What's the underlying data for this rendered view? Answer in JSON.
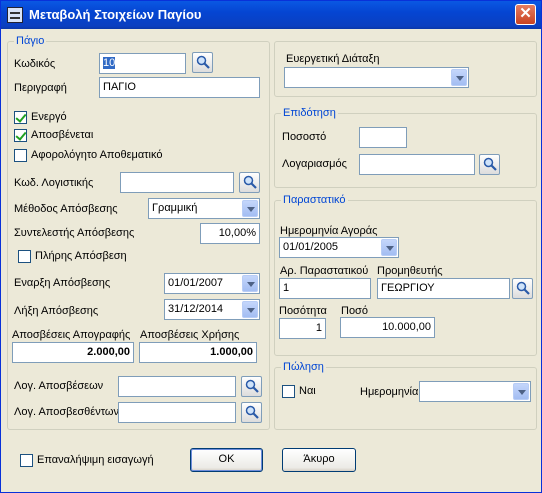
{
  "window": {
    "title": "Μεταβολή Στοιχείων Παγίου",
    "close": "✕"
  },
  "asset": {
    "legend": "Πάγιο",
    "code_label": "Κωδικός",
    "code_value": "10",
    "description_label": "Περιγραφή",
    "description_value": "ΠΑΓΙΟ",
    "active_label": "Ενεργό",
    "depreciated_label": "Αποσβένεται",
    "taxfree_label": "Αφορολόγητο Αποθεματικό",
    "account_code_label": "Κωδ. Λογιστικής",
    "account_code_value": "",
    "method_label": "Μέθοδος Απόσβεσης",
    "method_value": "Γραμμική",
    "rate_label": "Συντελεστής Απόσβεσης",
    "rate_value": "10,00%",
    "full_dep_label": "Πλήρης Απόσβεση",
    "start_label": "Εναρξη Απόσβεσης",
    "start_value": "01/01/2007",
    "end_label": "Λήξη Απόσβεσης",
    "end_value": "31/12/2014",
    "inventory_dep_label": "Αποσβέσεις Απογραφής",
    "inventory_dep_value": "2.000,00",
    "period_dep_label": "Αποσβέσεις Χρήσης",
    "period_dep_value": "1.000,00",
    "dep_account_label": "Λογ. Αποσβέσεων",
    "dep_account_value": "",
    "accum_account_label": "Λογ. Αποσβεσθέντων",
    "accum_account_value": ""
  },
  "enabling_provision": {
    "label": "Ευεργετική Διάταξη",
    "value": ""
  },
  "subsidy": {
    "legend": "Επιδότηση",
    "percent_label": "Ποσοστό",
    "percent_value": "",
    "account_label": "Λογαριασμός",
    "account_value": ""
  },
  "document": {
    "legend": "Παραστατικό",
    "purchase_date_label": "Ημερομηνία Αγοράς",
    "purchase_date_value": "01/01/2005",
    "doc_no_label": "Αρ. Παραστατικού",
    "doc_no_value": "1",
    "supplier_label": "Προμηθευτής",
    "supplier_value": "ΓΕΩΡΓΙΟΥ",
    "qty_label": "Ποσότητα",
    "qty_value": "1",
    "amount_label": "Ποσό",
    "amount_value": "10.000,00"
  },
  "sale": {
    "legend": "Πώληση",
    "yes_label": "Ναι",
    "date_label": "Ημερομηνία",
    "date_value": ""
  },
  "footer": {
    "repeat_label": "Επαναλήψιμη εισαγωγή",
    "ok_label": "OK",
    "cancel_label": "Άκυρο"
  }
}
